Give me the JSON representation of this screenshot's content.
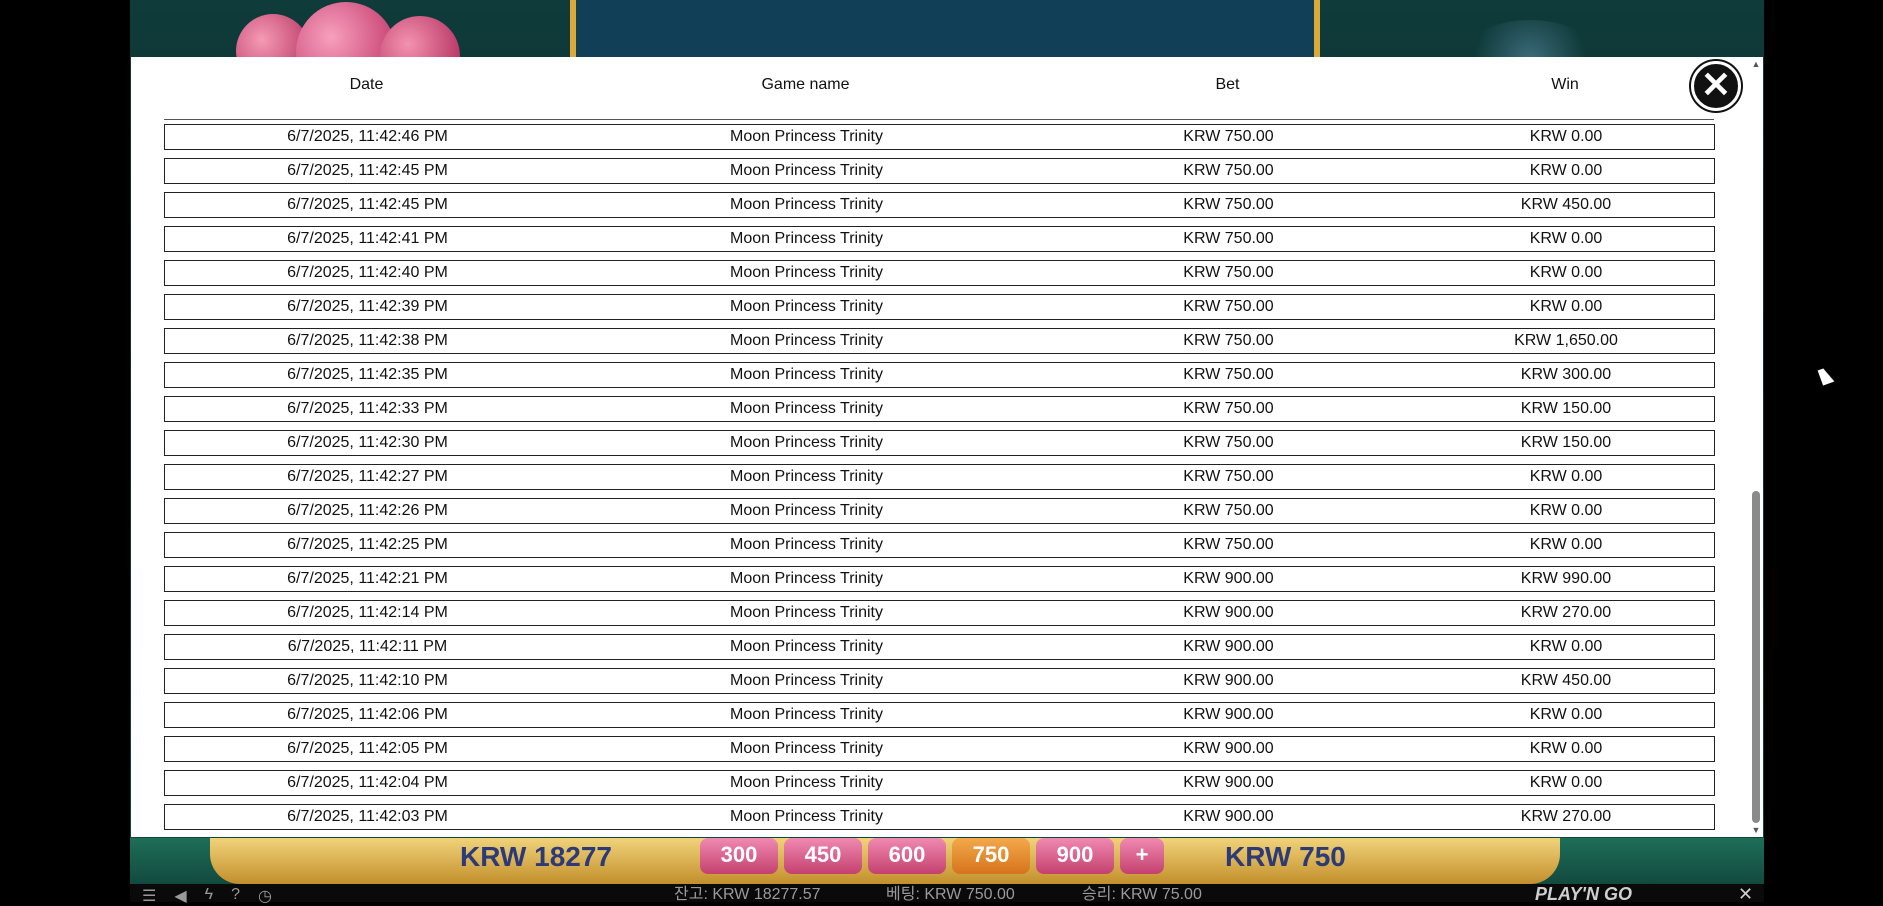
{
  "table": {
    "columns": [
      "Date",
      "Game name",
      "Bet",
      "Win"
    ],
    "rows": [
      [
        "6/7/2025, 11:42:46 PM",
        "Moon Princess Trinity",
        "KRW 750.00",
        "KRW 0.00"
      ],
      [
        "6/7/2025, 11:42:45 PM",
        "Moon Princess Trinity",
        "KRW 750.00",
        "KRW 0.00"
      ],
      [
        "6/7/2025, 11:42:45 PM",
        "Moon Princess Trinity",
        "KRW 750.00",
        "KRW 450.00"
      ],
      [
        "6/7/2025, 11:42:41 PM",
        "Moon Princess Trinity",
        "KRW 750.00",
        "KRW 0.00"
      ],
      [
        "6/7/2025, 11:42:40 PM",
        "Moon Princess Trinity",
        "KRW 750.00",
        "KRW 0.00"
      ],
      [
        "6/7/2025, 11:42:39 PM",
        "Moon Princess Trinity",
        "KRW 750.00",
        "KRW 0.00"
      ],
      [
        "6/7/2025, 11:42:38 PM",
        "Moon Princess Trinity",
        "KRW 750.00",
        "KRW 1,650.00"
      ],
      [
        "6/7/2025, 11:42:35 PM",
        "Moon Princess Trinity",
        "KRW 750.00",
        "KRW 300.00"
      ],
      [
        "6/7/2025, 11:42:33 PM",
        "Moon Princess Trinity",
        "KRW 750.00",
        "KRW 150.00"
      ],
      [
        "6/7/2025, 11:42:30 PM",
        "Moon Princess Trinity",
        "KRW 750.00",
        "KRW 150.00"
      ],
      [
        "6/7/2025, 11:42:27 PM",
        "Moon Princess Trinity",
        "KRW 750.00",
        "KRW 0.00"
      ],
      [
        "6/7/2025, 11:42:26 PM",
        "Moon Princess Trinity",
        "KRW 750.00",
        "KRW 0.00"
      ],
      [
        "6/7/2025, 11:42:25 PM",
        "Moon Princess Trinity",
        "KRW 750.00",
        "KRW 0.00"
      ],
      [
        "6/7/2025, 11:42:21 PM",
        "Moon Princess Trinity",
        "KRW 900.00",
        "KRW 990.00"
      ],
      [
        "6/7/2025, 11:42:14 PM",
        "Moon Princess Trinity",
        "KRW 900.00",
        "KRW 270.00"
      ],
      [
        "6/7/2025, 11:42:11 PM",
        "Moon Princess Trinity",
        "KRW 900.00",
        "KRW 0.00"
      ],
      [
        "6/7/2025, 11:42:10 PM",
        "Moon Princess Trinity",
        "KRW 900.00",
        "KRW 450.00"
      ],
      [
        "6/7/2025, 11:42:06 PM",
        "Moon Princess Trinity",
        "KRW 900.00",
        "KRW 0.00"
      ],
      [
        "6/7/2025, 11:42:05 PM",
        "Moon Princess Trinity",
        "KRW 900.00",
        "KRW 0.00"
      ],
      [
        "6/7/2025, 11:42:04 PM",
        "Moon Princess Trinity",
        "KRW 900.00",
        "KRW 0.00"
      ],
      [
        "6/7/2025, 11:42:03 PM",
        "Moon Princess Trinity",
        "KRW 900.00",
        "KRW 270.00"
      ]
    ]
  },
  "modal": {
    "close_glyph": "✕"
  },
  "game": {
    "balance_display": "KRW 18277",
    "bet_options": [
      "300",
      "450",
      "600",
      "750",
      "900",
      "+"
    ],
    "selected_bet_index": 3,
    "bet_display": "KRW 750"
  },
  "status_bar": {
    "balance": "잔고: KRW 18277.57",
    "bet": "베팅: KRW 750.00",
    "win": "승리: KRW 75.00",
    "brand": "PLAY'N GO",
    "icons": [
      "menu-icon",
      "sound-icon",
      "turbo-icon",
      "help-icon",
      "history-icon",
      "close-icon"
    ]
  },
  "colors": {
    "modal_bg": "#ffffff",
    "close_button": "#111111",
    "row_border": "#222222",
    "game_bg": "#0f3b3a",
    "gold": "#d9a93a"
  }
}
